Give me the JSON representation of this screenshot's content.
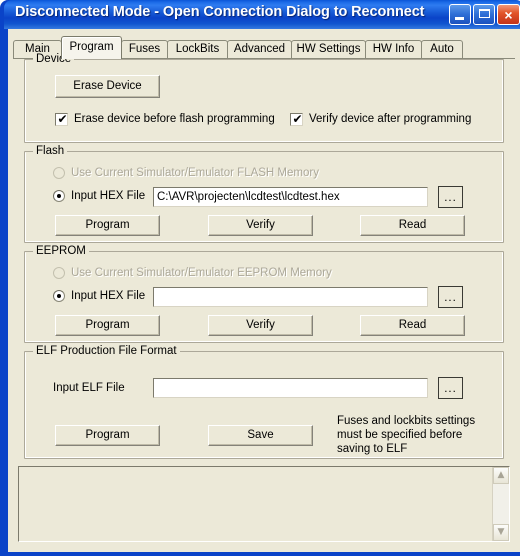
{
  "window": {
    "title": "Disconnected Mode - Open Connection Dialog to Reconnect",
    "minimize_label": "_",
    "maximize_label": "",
    "close_label": "×",
    "accent_color": "#0A43C8",
    "titlebar_text_color": "#FFFFFF",
    "client_bg": "#ECE9D8"
  },
  "tabs": [
    {
      "label": "Main",
      "active": false
    },
    {
      "label": "Program",
      "active": true
    },
    {
      "label": "Fuses",
      "active": false
    },
    {
      "label": "LockBits",
      "active": false
    },
    {
      "label": "Advanced",
      "active": false
    },
    {
      "label": "HW Settings",
      "active": false
    },
    {
      "label": "HW Info",
      "active": false
    },
    {
      "label": "Auto",
      "active": false
    }
  ],
  "device": {
    "group_title": "Device",
    "erase_button": "Erase Device",
    "checkbox_erase_before": {
      "label": "Erase device before flash programming",
      "checked": true,
      "tick": "✔"
    },
    "checkbox_verify_after": {
      "label": "Verify device after programming",
      "checked": true,
      "tick": "✔"
    }
  },
  "flash": {
    "group_title": "Flash",
    "radio_use_current": {
      "label": "Use Current Simulator/Emulator FLASH Memory",
      "selected": false,
      "enabled": false
    },
    "radio_input_hex": {
      "label": "Input HEX File",
      "selected": true,
      "enabled": true
    },
    "hex_path_value": "C:\\AVR\\projecten\\lcdtest\\lcdtest.hex",
    "hex_path_placeholder": "",
    "browse_label": "...",
    "program_label": "Program",
    "verify_label": "Verify",
    "read_label": "Read"
  },
  "eeprom": {
    "group_title": "EEPROM",
    "radio_use_current": {
      "label": "Use Current Simulator/Emulator EEPROM Memory",
      "selected": false,
      "enabled": false
    },
    "radio_input_hex": {
      "label": "Input HEX File",
      "selected": true,
      "enabled": true
    },
    "hex_path_value": "",
    "hex_path_placeholder": "",
    "browse_label": "...",
    "program_label": "Program",
    "verify_label": "Verify",
    "read_label": "Read"
  },
  "elf": {
    "group_title": "ELF Production File Format",
    "input_label": "Input ELF File",
    "elf_path_value": "",
    "elf_path_placeholder": "",
    "browse_label": "...",
    "program_label": "Program",
    "save_label": "Save",
    "note": "Fuses and lockbits settings must be specified before saving to ELF"
  },
  "log": {
    "content": "",
    "scroll_up_icon": "▲",
    "scroll_down_icon": "▼"
  }
}
